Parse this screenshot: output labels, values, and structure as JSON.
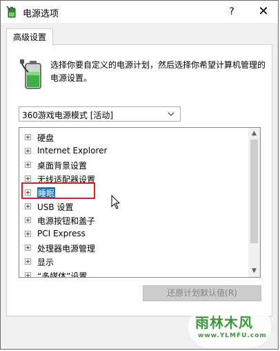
{
  "window": {
    "title": "电源选项",
    "help_glyph": "?",
    "close_glyph": "✕"
  },
  "tabs": [
    {
      "label": "高级设置",
      "active": true
    }
  ],
  "description": "选择你要自定义的电源计划，然后选择你希望计算机管理的电源设置。",
  "plan_select": {
    "value": "360游戏电源模式 [活动]"
  },
  "tree": {
    "items": [
      {
        "label": "硬盘"
      },
      {
        "label": "Internet Explorer"
      },
      {
        "label": "桌面背景设置"
      },
      {
        "label": "无线适配器设置"
      },
      {
        "label": "睡眠",
        "selected": true
      },
      {
        "label": "USB 设置"
      },
      {
        "label": "电源按钮和盖子"
      },
      {
        "label": "PCI Express"
      },
      {
        "label": "处理器电源管理"
      },
      {
        "label": "显示"
      },
      {
        "label": "“多媒体”设置"
      }
    ],
    "scroll_up_glyph": "▲",
    "scroll_down_glyph": "▼"
  },
  "restore_button": {
    "label": "还原计划默认值(R)"
  },
  "watermark": {
    "title": "雨林木风",
    "url": "www.YLMFU.com"
  },
  "icons": {
    "app": "battery-power-icon",
    "battery": "battery-plan-icon",
    "cursor": "mouse-cursor-icon"
  },
  "colors": {
    "selection": "#0078d7",
    "highlight": "#e02020",
    "watermark": "#3a9a3a"
  }
}
